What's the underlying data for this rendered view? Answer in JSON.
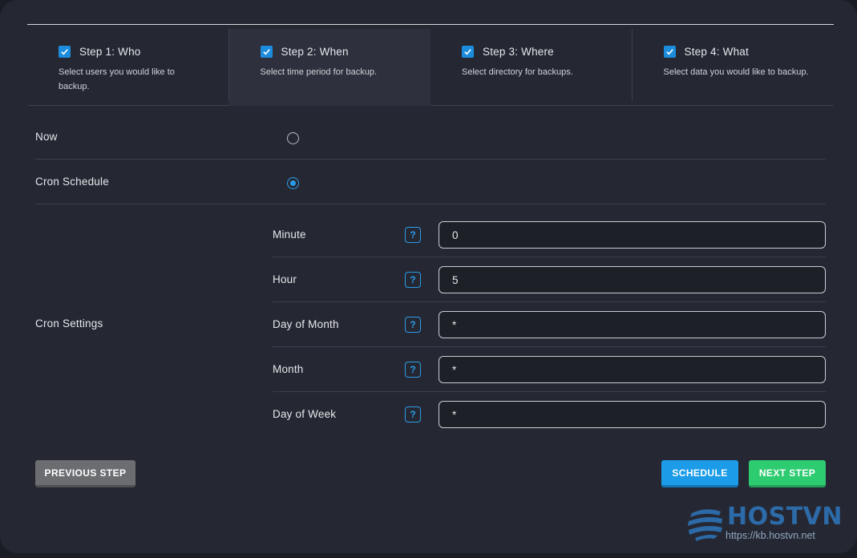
{
  "steps": [
    {
      "title": "Step 1: Who",
      "desc": "Select users you would like to backup.",
      "checked": true
    },
    {
      "title": "Step 2: When",
      "desc": "Select time period for backup.",
      "checked": true
    },
    {
      "title": "Step 3: Where",
      "desc": "Select directory for backups.",
      "checked": true
    },
    {
      "title": "Step 4: What",
      "desc": "Select data you would like to backup.",
      "checked": true
    }
  ],
  "options": {
    "now_label": "Now",
    "cron_label": "Cron Schedule",
    "selected": "cron"
  },
  "cron": {
    "label": "Cron Settings",
    "help_glyph": "?",
    "fields": [
      {
        "name": "Minute",
        "value": "0"
      },
      {
        "name": "Hour",
        "value": "5"
      },
      {
        "name": "Day of Month",
        "value": "*"
      },
      {
        "name": "Month",
        "value": "*"
      },
      {
        "name": "Day of Week",
        "value": "*"
      }
    ]
  },
  "buttons": {
    "previous": "PREVIOUS STEP",
    "schedule": "SCHEDULE",
    "next": "NEXT STEP"
  },
  "watermark": {
    "brand": "HOSTVN",
    "url": "https://kb.hostvn.net"
  },
  "colors": {
    "accent": "#1c9ce8",
    "next": "#2ecc71",
    "previous": "#6b6d71"
  }
}
